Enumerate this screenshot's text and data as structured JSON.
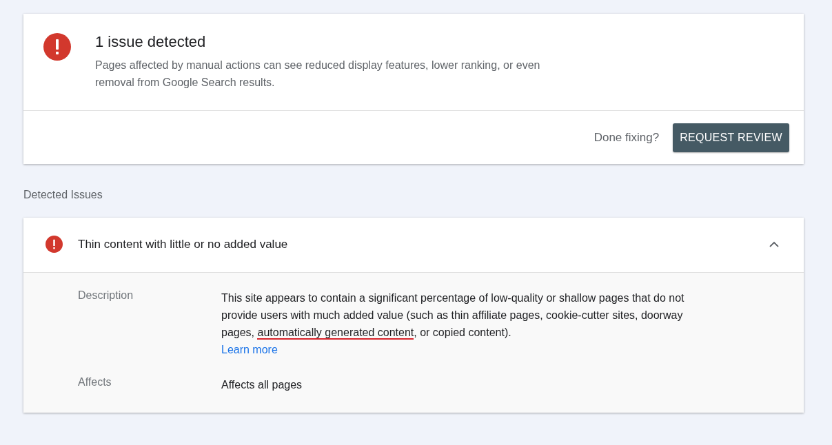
{
  "summary": {
    "title": "1 issue detected",
    "text": "Pages affected by manual actions can see reduced display features, lower ranking, or even removal from Google Search results.",
    "prompt": "Done fixing?",
    "button": "REQUEST REVIEW"
  },
  "section_title": "Detected Issues",
  "issue": {
    "title": "Thin content with little or no added value",
    "expanded": true,
    "details": [
      {
        "kind": "text",
        "label": "Description",
        "before": "This site appears to contain a significant percentage of low-quality or shallow pages that do not provide users with much added value (such as thin affiliate pages, cookie-cutter sites, doorway pages, ",
        "highlighted": "automatically generated content",
        "after": ", or copied content).",
        "link": "Learn more"
      },
      {
        "kind": "plain",
        "label": "Affects",
        "value": "Affects all pages"
      }
    ]
  }
}
